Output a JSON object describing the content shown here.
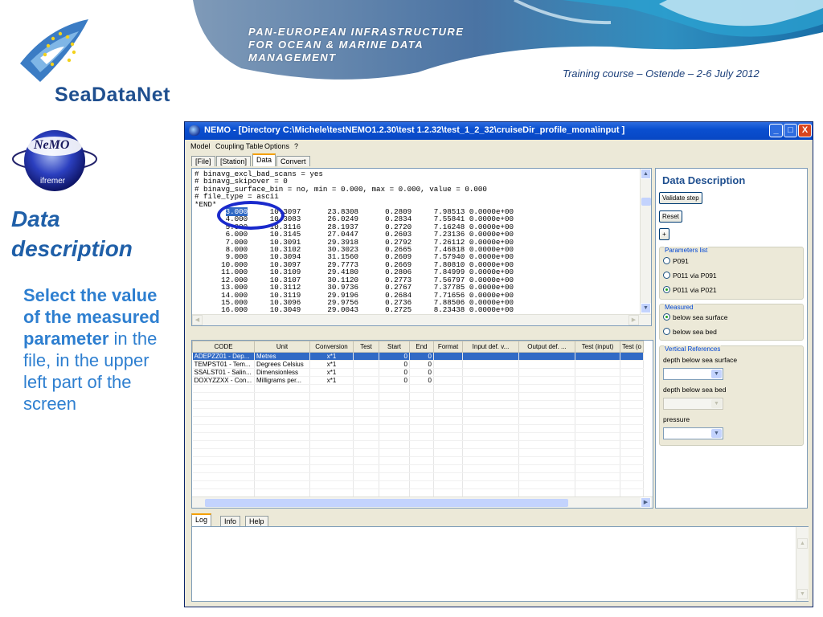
{
  "slide": {
    "logo_name": "SeaDataNet",
    "infrastructure_lines": [
      "PAN-EUROPEAN INFRASTRUCTURE",
      "FOR OCEAN & MARINE DATA",
      "MANAGEMENT"
    ],
    "training_course": "Training course – Ostende – 2-6 July 2012",
    "nemo_logo": {
      "word": "NeMO",
      "sub": "ifremer"
    },
    "side_title_lines": [
      "Data",
      "description"
    ],
    "side_text": {
      "bold": "Select the value of the measured parameter",
      "rest": " in the file, in the upper left part of the screen"
    }
  },
  "window": {
    "title": "NEMO - [Directory C:\\Michele\\testNEMO1.2.30\\test 1.2.32\\test_1_2_32\\cruiseDir_profile_mona\\input ]",
    "controls": {
      "minimize": "_",
      "maximize": "□",
      "close": "X"
    },
    "menu": [
      "Model",
      "Coupling Table",
      "Options",
      "?"
    ],
    "tabs": [
      "[File]",
      "[Station]",
      "Data",
      "Convert"
    ],
    "active_tab": "Data",
    "file_lines": [
      "# binavg_excl_bad_scans = yes",
      "# binavg_skipover = 0",
      "# binavg_surface_bin = no, min = 0.000, max = 0.000, value = 0.000",
      "# file_type = ascii",
      "*END*",
      "       3.000     10.3097      23.8308      0.2809     7.98513 0.0000e+00",
      "       4.000     10.3083      26.0249      0.2834     7.55841 0.0000e+00",
      "       5.000     10.3116      28.1937      0.2720     7.16248 0.0000e+00",
      "       6.000     10.3145      27.0447      0.2603     7.23136 0.0000e+00",
      "       7.000     10.3091      29.3918      0.2792     7.26112 0.0000e+00",
      "       8.000     10.3102      30.3023      0.2665     7.46818 0.0000e+00",
      "       9.000     10.3094      31.1560      0.2609     7.57940 0.0000e+00",
      "      10.000     10.3097      29.7773      0.2669     7.80810 0.0000e+00",
      "      11.000     10.3109      29.4180      0.2806     7.84999 0.0000e+00",
      "      12.000     10.3107      30.1120      0.2773     7.56797 0.0000e+00",
      "      13.000     10.3112      30.9736      0.2767     7.37785 0.0000e+00",
      "      14.000     10.3119      29.9196      0.2684     7.71656 0.0000e+00",
      "      15.000     10.3096      29.9756      0.2736     7.88506 0.0000e+00",
      "      16.000     10.3049      29.0043      0.2725     8.23438 0.0000e+00"
    ],
    "table": {
      "columns": [
        "CODE",
        "Unit",
        "Conversion",
        "Test",
        "Start",
        "End",
        "Format",
        "Input def. v...",
        "Output def. ...",
        "Test (input)",
        "Test (o"
      ],
      "rows": [
        [
          "ADEPZZ01 - Dep...",
          "Metres",
          "x*1",
          "",
          "0",
          "0",
          "",
          "",
          "",
          "",
          ""
        ],
        [
          "TEMPST01 - Tem...",
          "Degrees Celsius",
          "x*1",
          "",
          "0",
          "0",
          "",
          "",
          "",
          "",
          ""
        ],
        [
          "SSALST01 - Salin...",
          "Dimensionless",
          "x*1",
          "",
          "0",
          "0",
          "",
          "",
          "",
          "",
          ""
        ],
        [
          "DOXYZZXX - Con...",
          "Milligrams per...",
          "x*1",
          "",
          "0",
          "0",
          "",
          "",
          "",
          "",
          ""
        ]
      ],
      "selected_row": 0
    },
    "panel": {
      "title": "Data Description",
      "validate_button": "Validate step",
      "reset_button": "Reset",
      "plus_button": "+",
      "parameters_legend": "Parameters list",
      "parameters": [
        "P091",
        "P011 via P091",
        "P011 via P021"
      ],
      "parameters_selected": "P011 via P021",
      "measured_legend": "Measured",
      "measured": [
        "below sea surface",
        "below sea bed"
      ],
      "measured_selected": "below sea surface",
      "vertical_legend": "Vertical References",
      "vertical_labels": [
        "depth below sea surface",
        "depth below sea bed",
        "pressure"
      ]
    },
    "log_tabs": [
      "Log",
      "Info",
      "Help"
    ],
    "log_active": "Log"
  }
}
